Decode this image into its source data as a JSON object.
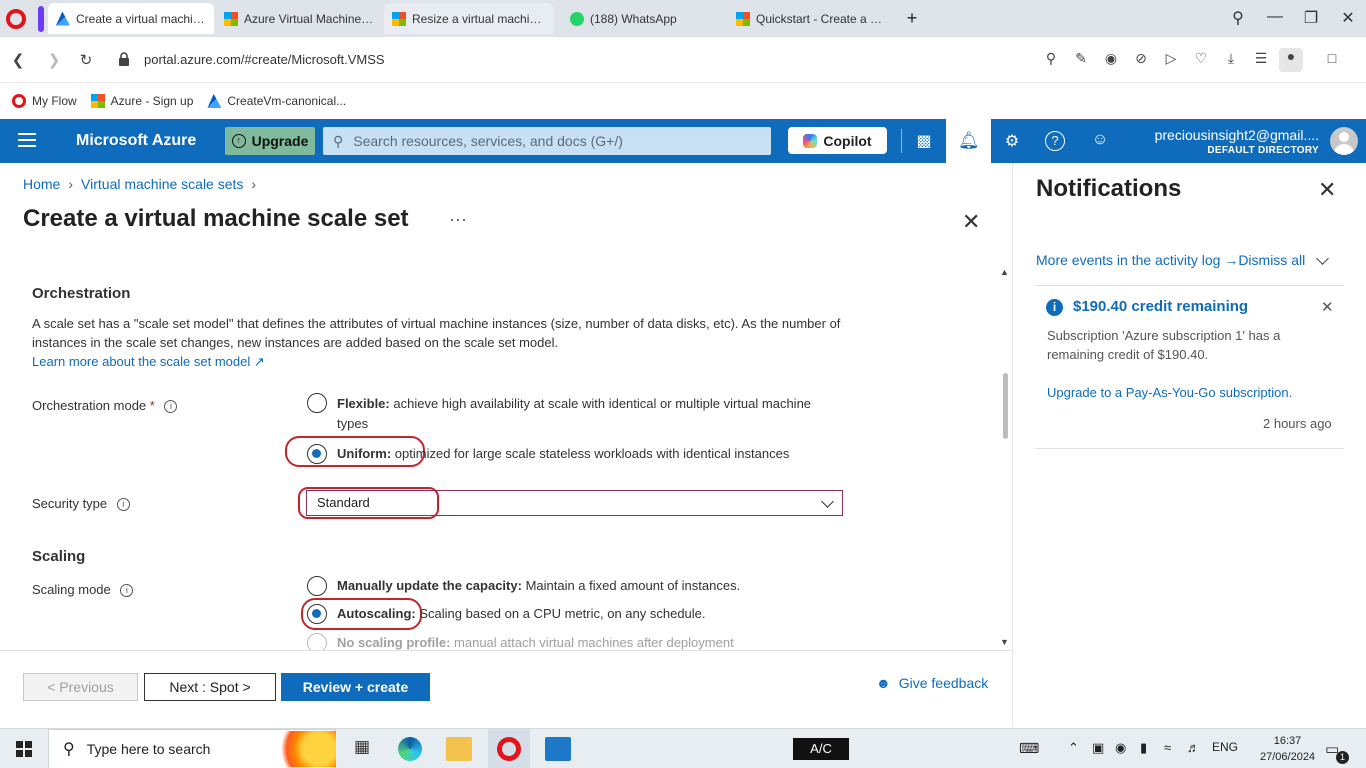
{
  "browser": {
    "tabs": [
      {
        "title": "Create a virtual machine s",
        "icon": "azure-icon",
        "active": true
      },
      {
        "title": "Azure Virtual Machine Sca",
        "icon": "microsoft-icon",
        "active": false
      },
      {
        "title": "Resize a virtual machine -",
        "icon": "microsoft-icon",
        "active": false
      },
      {
        "title": "(188) WhatsApp",
        "icon": "whatsapp-icon",
        "active": false
      },
      {
        "title": "Quickstart - Create a Virtu",
        "icon": "microsoft-icon",
        "active": false
      }
    ],
    "url": "portal.azure.com/#create/Microsoft.VMSS",
    "bookmarks": [
      {
        "label": "My Flow",
        "icon": "opera-icon"
      },
      {
        "label": "Azure - Sign up",
        "icon": "microsoft-icon"
      },
      {
        "label": "CreateVm-canonical...",
        "icon": "azure-icon"
      }
    ]
  },
  "azure_header": {
    "title": "Microsoft Azure",
    "upgrade_label": "Upgrade",
    "search_placeholder": "Search resources, services, and docs (G+/)",
    "copilot_label": "Copilot",
    "user_name": "preciousinsight2@gmail....",
    "directory": "DEFAULT DIRECTORY"
  },
  "blade": {
    "breadcrumb": [
      "Home",
      "Virtual machine scale sets"
    ],
    "title": "Create a virtual machine scale set",
    "orchestration": {
      "heading": "Orchestration",
      "description": "A scale set has a \"scale set model\" that defines the attributes of virtual machine instances (size, number of data disks, etc). As the number of instances in the scale set changes, new instances are added based on the scale set model.",
      "learn_more": "Learn more about the scale set model",
      "mode_label": "Orchestration mode",
      "required_mark": "*",
      "options": [
        {
          "name": "Flexible:",
          "desc": "achieve high availability at scale with identical or multiple virtual machine types",
          "selected": false
        },
        {
          "name": "Uniform:",
          "desc": "optimized for large scale stateless workloads with identical instances",
          "selected": true
        }
      ],
      "security_label": "Security type",
      "security_value": "Standard"
    },
    "scaling": {
      "heading": "Scaling",
      "mode_label": "Scaling mode",
      "options": [
        {
          "name": "Manually update the capacity:",
          "desc": "Maintain a fixed amount of instances.",
          "selected": false
        },
        {
          "name": "Autoscaling:",
          "desc": "Scaling based on a CPU metric, on any schedule.",
          "selected": true
        },
        {
          "name": "No scaling profile:",
          "desc": "manual attach virtual machines after deployment",
          "selected": false
        }
      ]
    },
    "footer": {
      "previous": "< Previous",
      "next": "Next : Spot >",
      "review": "Review + create",
      "feedback": "Give feedback"
    }
  },
  "notifications": {
    "title": "Notifications",
    "activity_link": "More events in the activity log →",
    "dismiss_all": "Dismiss all",
    "item": {
      "title": "$190.40 credit remaining",
      "body": "Subscription 'Azure subscription 1' has a remaining credit of $190.40.",
      "link": "Upgrade to a Pay-As-You-Go subscription.",
      "time": "2 hours ago"
    }
  },
  "taskbar": {
    "search_placeholder": "Type here to search",
    "badge": "A/C",
    "language": "ENG",
    "time": "16:37",
    "date": "27/06/2024",
    "notification_count": "1"
  },
  "colors": {
    "azure_blue": "#0f6cbd",
    "annotation_red": "#c0272d"
  }
}
